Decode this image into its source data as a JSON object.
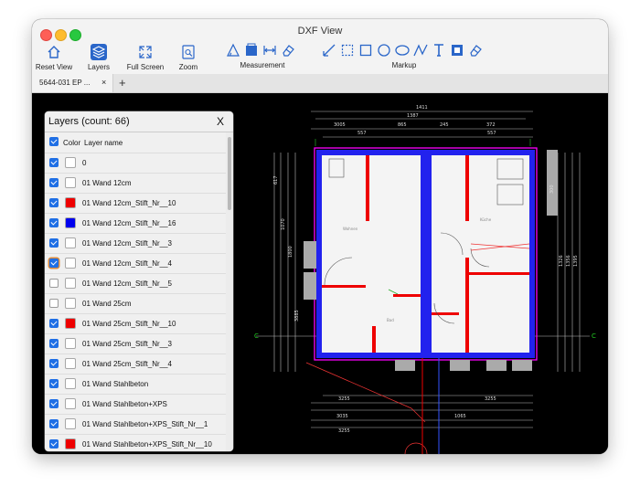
{
  "window": {
    "title": "DXF View"
  },
  "toolbar": {
    "reset_view": "Reset View",
    "layers": "Layers",
    "full_screen": "Full Screen",
    "zoom": "Zoom",
    "measurement": "Measurement",
    "markup": "Markup"
  },
  "tabs": [
    {
      "label": "5644-031 EP ...",
      "close": "×"
    }
  ],
  "add_tab": "+",
  "layers_panel": {
    "title": "Layers (count: 66)",
    "close": "X",
    "col_color": "Color",
    "col_name": "Layer name",
    "rows": [
      {
        "name": "0",
        "checked": true,
        "color": "#ffffff"
      },
      {
        "name": "01 Wand 12cm",
        "checked": true,
        "color": "#ffffff"
      },
      {
        "name": "01 Wand 12cm_Stift_Nr__10",
        "checked": true,
        "color": "#ee0000"
      },
      {
        "name": "01 Wand 12cm_Stift_Nr__16",
        "checked": true,
        "color": "#0000ee"
      },
      {
        "name": "01 Wand 12cm_Stift_Nr__3",
        "checked": true,
        "color": "#ffffff"
      },
      {
        "name": "01 Wand 12cm_Stift_Nr__4",
        "checked": true,
        "color": "#ffffff"
      },
      {
        "name": "01 Wand 12cm_Stift_Nr__5",
        "checked": false,
        "color": "#ffffff"
      },
      {
        "name": "01 Wand 25cm",
        "checked": false,
        "color": "#ffffff"
      },
      {
        "name": "01 Wand 25cm_Stift_Nr__10",
        "checked": true,
        "color": "#ee0000"
      },
      {
        "name": "01 Wand 25cm_Stift_Nr__3",
        "checked": true,
        "color": "#ffffff"
      },
      {
        "name": "01 Wand 25cm_Stift_Nr__4",
        "checked": true,
        "color": "#ffffff"
      },
      {
        "name": "01 Wand Stahlbeton",
        "checked": true,
        "color": "#ffffff"
      },
      {
        "name": "01 Wand Stahlbeton+XPS",
        "checked": true,
        "color": "#ffffff"
      },
      {
        "name": "01 Wand Stahlbeton+XPS_Stift_Nr__1",
        "checked": true,
        "color": "#ffffff"
      },
      {
        "name": "01 Wand Stahlbeton+XPS_Stift_Nr__10",
        "checked": true,
        "color": "#ee0000"
      }
    ]
  },
  "drawing": {
    "top_dims": [
      "1411",
      "1387",
      "3005",
      "25",
      "865",
      "25",
      "245",
      "25",
      "372",
      "25",
      "557",
      "73",
      "10",
      "557"
    ],
    "bottom_dims": [
      "3255",
      "25",
      "865",
      "25",
      "100",
      "25",
      "865",
      "25",
      "25",
      "3255",
      "25",
      "1065",
      "25",
      "3035",
      "25",
      "1065",
      "25",
      "3255",
      "25"
    ],
    "left_dims": [
      "617",
      "1065",
      "1070",
      "1800",
      "3885",
      "1600",
      "865",
      "25"
    ],
    "right_dims": [
      "1326",
      "1356",
      "1395",
      "300"
    ],
    "section_marks": [
      "C",
      "C"
    ],
    "room_text": [
      "Wohnen",
      "Küche",
      "Bad"
    ]
  }
}
